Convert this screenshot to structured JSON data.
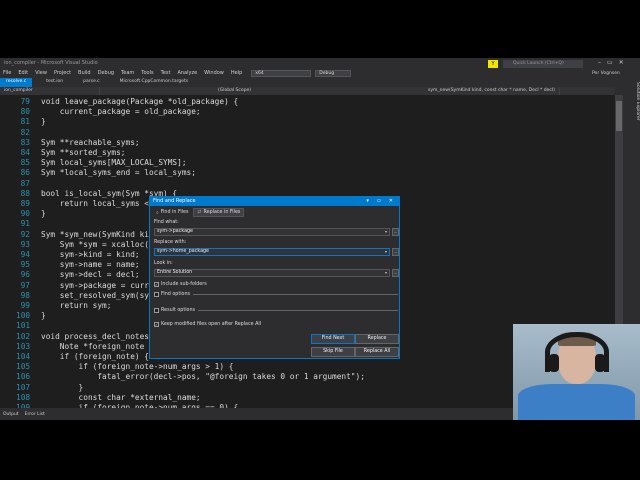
{
  "window": {
    "title": "ion_compiler - Microsoft Visual Studio",
    "notify": "Y",
    "quick_launch": "Quick Launch (Ctrl+Q)",
    "user": "Per Vognsen"
  },
  "menu": [
    "File",
    "Edit",
    "View",
    "Project",
    "Build",
    "Debug",
    "Team",
    "Tools",
    "Test",
    "Analyze",
    "Window",
    "Help"
  ],
  "toolbar": {
    "platform": "x64",
    "config": "Debug"
  },
  "tabs": [
    "resolve.c",
    "test.ion",
    "parse.c",
    "Microsoft.CppCommon.targets"
  ],
  "nav": {
    "project": "ion_compiler",
    "scope": "(Global Scope)",
    "member": "sym_new(SymKind kind, const char * name, Decl * decl)"
  },
  "side_panel": "Solution Explorer",
  "code": [
    {
      "n": "79",
      "t": "void leave_package(Package *old_package) {"
    },
    {
      "n": "80",
      "t": "    current_package = old_package;"
    },
    {
      "n": "81",
      "t": "}"
    },
    {
      "n": "82",
      "t": ""
    },
    {
      "n": "83",
      "t": "Sym **reachable_syms;"
    },
    {
      "n": "84",
      "t": "Sym **sorted_syms;"
    },
    {
      "n": "85",
      "t": "Sym local_syms[MAX_LOCAL_SYMS];"
    },
    {
      "n": "86",
      "t": "Sym *local_syms_end = local_syms;"
    },
    {
      "n": "87",
      "t": ""
    },
    {
      "n": "88",
      "t": "bool is_local_sym(Sym *sym) {"
    },
    {
      "n": "89",
      "t": "    return local_syms <= "
    },
    {
      "n": "90",
      "t": "}"
    },
    {
      "n": "91",
      "t": ""
    },
    {
      "n": "92",
      "t": "Sym *sym_new(SymKind kind"
    },
    {
      "n": "93",
      "t": "    Sym *sym = xcalloc(1,"
    },
    {
      "n": "94",
      "t": "    sym->kind = kind;"
    },
    {
      "n": "95",
      "t": "    sym->name = name;"
    },
    {
      "n": "96",
      "t": "    sym->decl = decl;"
    },
    {
      "n": "97",
      "t": "    sym->package = current"
    },
    {
      "n": "98",
      "t": "    set_resolved_sym(sym,"
    },
    {
      "n": "99",
      "t": "    return sym;"
    },
    {
      "n": "100",
      "t": "}"
    },
    {
      "n": "101",
      "t": ""
    },
    {
      "n": "102",
      "t": "void process_decl_notes(De"
    },
    {
      "n": "103",
      "t": "    Note *foreign_note = g"
    },
    {
      "n": "104",
      "t": "    if (foreign_note) {"
    },
    {
      "n": "105",
      "t": "        if (foreign_note->num_args > 1) {"
    },
    {
      "n": "106",
      "t": "            fatal_error(decl->pos, \"@foreign takes 0 or 1 argument\");"
    },
    {
      "n": "107",
      "t": "        }"
    },
    {
      "n": "108",
      "t": "        const char *external_name;"
    },
    {
      "n": "109",
      "t": "        if (foreign_note->num_args == 0) {"
    }
  ],
  "dialog": {
    "title": "Find and Replace",
    "controls": "▾ ▭ ✕",
    "tab_find": "Find in Files",
    "tab_replace": "Replace in Files",
    "find_label": "Find what:",
    "find_value": "sym->package",
    "replace_label": "Replace with:",
    "replace_value": "sym->home_package",
    "look_label": "Look in:",
    "look_value": "Entire Solution",
    "include_sub": "Include sub-folders",
    "find_options": "Find options",
    "result_options": "Result options",
    "keep_open": "Keep modified files open after Replace All",
    "btn_find_next": "Find Next",
    "btn_replace": "Replace",
    "btn_skip": "Skip File",
    "btn_replace_all": "Replace All",
    "browse": "...",
    "dropdown_arrow": "▾",
    "check_mark": "✓"
  },
  "status": [
    "Output",
    "Error List"
  ]
}
